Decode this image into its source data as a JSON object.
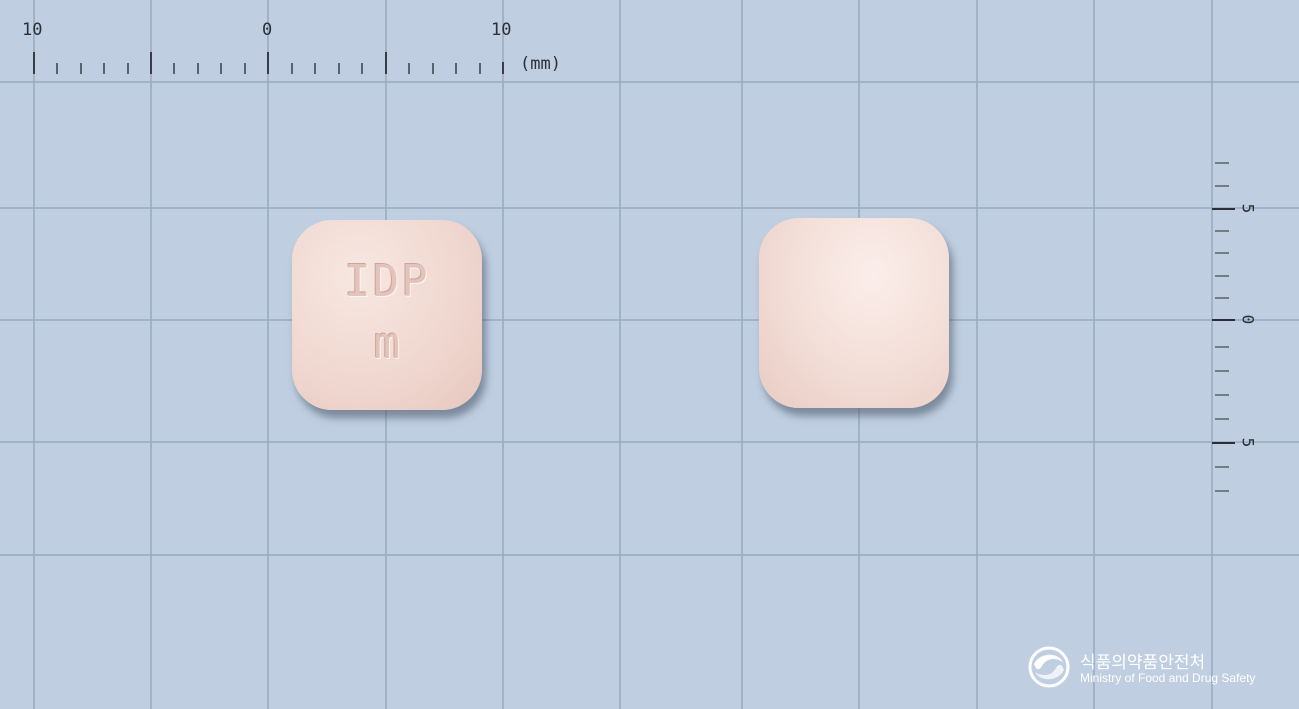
{
  "ruler_top": {
    "tick_labels": [
      "10",
      "0",
      "10"
    ],
    "unit": "(mm)"
  },
  "ruler_right": {
    "tick_labels": [
      "5",
      "0",
      "5"
    ]
  },
  "pill_front": {
    "imprint_line1": "IDP",
    "imprint_line2": "m",
    "color": "#f0d8d0"
  },
  "pill_back": {
    "color": "#f2ddd6"
  },
  "watermark": {
    "org_korean": "식품의약품안전처",
    "org_english": "Ministry of Food and Drug Safety"
  },
  "colors": {
    "background": "#bfcfe1",
    "grid_line": "#98aabf"
  }
}
